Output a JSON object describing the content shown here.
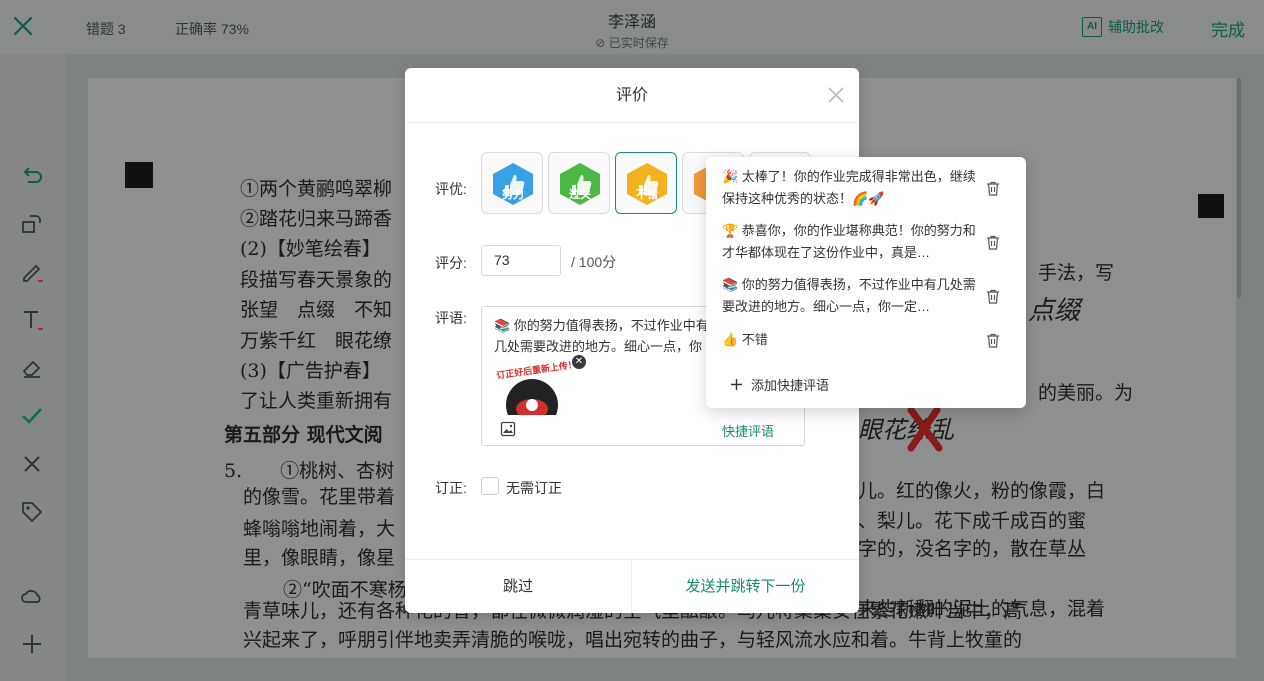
{
  "topbar": {
    "wrong_count": "错题 3",
    "accuracy": "正确率 73%",
    "student_name": "李泽涵",
    "save_status": "已实时保存",
    "assist_label": "辅助批改",
    "assist_icon_text": "AI",
    "done_label": "完成"
  },
  "rail_tools": [
    "undo-icon",
    "rotate-icon",
    "pen-icon",
    "text-icon",
    "eraser-icon",
    "check-icon",
    "cross-icon",
    "tag-icon",
    "cloud-icon",
    "plus-icon"
  ],
  "paper": {
    "lines": [
      "①两个黄鹂鸣翠柳",
      "②踏花归来马蹄香",
      "(2)【妙笔绘春】",
      "段描写春天景象的",
      "张望　点缀　不知",
      "万紫千红　眼花缭",
      "(3)【广告护春】",
      "了让人类重新拥有",
      "第五部分 现代文阅",
      "5.　　①桃树、杏树",
      "的像雪。花里带着",
      "蜂嗡嗡地闹着，大",
      "里，像眼睛，像星",
      "②“吹面不寒杨",
      "青草味儿，还有各种花的香，都在微微润湿的空气里酝酿。鸟儿将窠巢安在繁花嫩叶当中，高",
      "兴起来了，呼朋引伴地卖弄清脆的喉咙，唱出宛转的曲子，与轻风流水应和着。牛背上牧童的"
    ],
    "right_lines": [
      "手法，写",
      "点缀",
      "的美丽。为",
      "儿。红的像火，粉的像霞，白",
      "、梨儿。花下成千成百的蜜",
      "字的，没名字的，散在草丛",
      "来些新翻的泥土的气息，混着"
    ],
    "handwriting": "眼花缭乱"
  },
  "dialog": {
    "title": "评价",
    "rating_label": "评优:",
    "badges": [
      {
        "text": "努力",
        "color": "#3aa0e6"
      },
      {
        "text": "过关",
        "color": "#4cb843"
      },
      {
        "text": "不错",
        "color": "#f3b21e"
      },
      {
        "text": "良",
        "color": "#f39a3a"
      },
      {
        "text": "",
        "color": "#f07a6a"
      }
    ],
    "score_label": "评分:",
    "score_value": "73",
    "score_unit": "/ 100分",
    "comment_label": "评语:",
    "comment_text": "📚 你的努力值得表扬，不过作业中有几处需要改进的地方。细心一点，你一定可以",
    "sticker_text": "订正好后重新上传！",
    "quick_comment_link": "快捷评语",
    "revise_label": "订正:",
    "no_revise_label": "无需订正",
    "skip_label": "跳过",
    "send_label": "发送并跳转下一份"
  },
  "quick_comments": {
    "items": [
      "🎉 太棒了！你的作业完成得非常出色，继续保持这种优秀的状态！🌈🚀",
      "🏆 恭喜你，你的作业堪称典范！你的努力和才华都体现在了这份作业中，真是…",
      "📚 你的努力值得表扬，不过作业中有几处需要改进的地方。细心一点，你一定…",
      "👍 不错"
    ],
    "add_label": "添加快捷评语"
  },
  "colors": {
    "accent": "#1a8a72",
    "accent_dark": "#0d5b4a",
    "overlay_bg": "#7f8282"
  }
}
